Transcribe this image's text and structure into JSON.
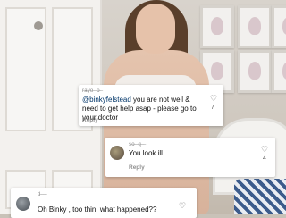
{
  "comments": [
    {
      "username": "r̶a̶y̶o̶ ̶ ̶o̶ ̶",
      "mention": "@binkyfelstead",
      "text": " you are not well & need to get help asap - please go to your doctor",
      "reply_label": "Reply",
      "likes": "7"
    },
    {
      "username": "s̶o̶ ̶ ̶q̶ ̶ ̶",
      "text": "You look ill",
      "reply_label": "Reply",
      "likes": "4"
    },
    {
      "username": "d̶ ̶ ̶ ̶",
      "text": "Oh Binky , too thin, what happened??"
    }
  ],
  "icons": {
    "like": "heart-outline-icon"
  }
}
